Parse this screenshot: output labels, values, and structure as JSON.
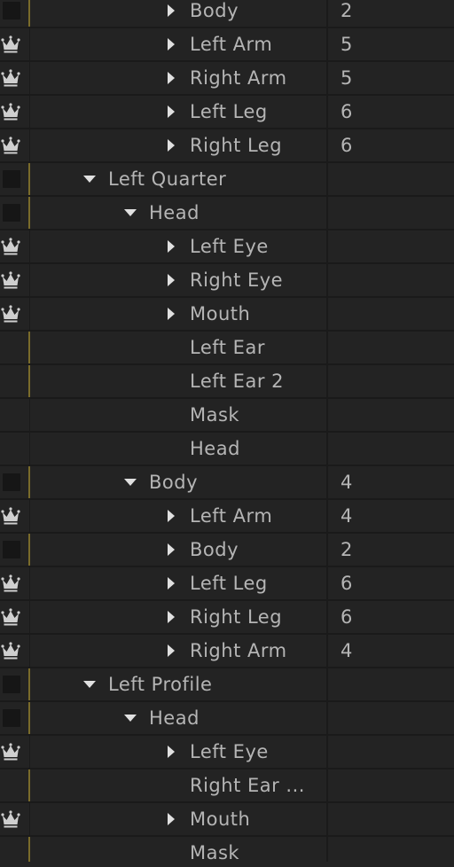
{
  "rows": [
    {
      "label": "Body",
      "value": "2",
      "icon": "box",
      "depth": 2,
      "arrow": "right",
      "accent": true
    },
    {
      "label": "Left Arm",
      "value": "5",
      "icon": "crown",
      "depth": 2,
      "arrow": "right",
      "accent": false
    },
    {
      "label": "Right Arm",
      "value": "5",
      "icon": "crown",
      "depth": 2,
      "arrow": "right",
      "accent": false
    },
    {
      "label": "Left Leg",
      "value": "6",
      "icon": "crown",
      "depth": 2,
      "arrow": "right",
      "accent": false
    },
    {
      "label": "Right Leg",
      "value": "6",
      "icon": "crown",
      "depth": 2,
      "arrow": "right",
      "accent": false
    },
    {
      "label": "Left Quarter",
      "value": "",
      "icon": "box",
      "depth": 0,
      "arrow": "down",
      "accent": true
    },
    {
      "label": "Head",
      "value": "",
      "icon": "box",
      "depth": 1,
      "arrow": "down",
      "accent": true
    },
    {
      "label": "Left Eye",
      "value": "",
      "icon": "crown",
      "depth": 2,
      "arrow": "right",
      "accent": false
    },
    {
      "label": "Right Eye",
      "value": "",
      "icon": "crown",
      "depth": 2,
      "arrow": "right",
      "accent": false
    },
    {
      "label": "Mouth",
      "value": "",
      "icon": "crown",
      "depth": 2,
      "arrow": "right",
      "accent": false
    },
    {
      "label": "Left Ear",
      "value": "",
      "icon": "none",
      "depth": 2,
      "arrow": "none",
      "accent": true
    },
    {
      "label": "Left Ear 2",
      "value": "",
      "icon": "none",
      "depth": 2,
      "arrow": "none",
      "accent": true
    },
    {
      "label": "Mask",
      "value": "",
      "icon": "none",
      "depth": 2,
      "arrow": "none",
      "accent": false
    },
    {
      "label": "Head",
      "value": "",
      "icon": "none",
      "depth": 2,
      "arrow": "none",
      "accent": false
    },
    {
      "label": "Body",
      "value": "4",
      "icon": "box",
      "depth": 1,
      "arrow": "down",
      "accent": true
    },
    {
      "label": "Left Arm",
      "value": "4",
      "icon": "crown",
      "depth": 2,
      "arrow": "right",
      "accent": false
    },
    {
      "label": "Body",
      "value": "2",
      "icon": "box",
      "depth": 2,
      "arrow": "right",
      "accent": true
    },
    {
      "label": "Left Leg",
      "value": "6",
      "icon": "crown",
      "depth": 2,
      "arrow": "right",
      "accent": false
    },
    {
      "label": "Right Leg",
      "value": "6",
      "icon": "crown",
      "depth": 2,
      "arrow": "right",
      "accent": false
    },
    {
      "label": "Right Arm",
      "value": "4",
      "icon": "crown",
      "depth": 2,
      "arrow": "right",
      "accent": false
    },
    {
      "label": "Left Profile",
      "value": "",
      "icon": "box",
      "depth": 0,
      "arrow": "down",
      "accent": true
    },
    {
      "label": "Head",
      "value": "",
      "icon": "box",
      "depth": 1,
      "arrow": "down",
      "accent": true
    },
    {
      "label": "Left Eye",
      "value": "",
      "icon": "crown",
      "depth": 2,
      "arrow": "right",
      "accent": false
    },
    {
      "label": "Right Ear ...",
      "value": "",
      "icon": "none",
      "depth": 2,
      "arrow": "none",
      "accent": true
    },
    {
      "label": "Mouth",
      "value": "",
      "icon": "crown",
      "depth": 2,
      "arrow": "right",
      "accent": false
    },
    {
      "label": "Mask",
      "value": "",
      "icon": "none",
      "depth": 2,
      "arrow": "none",
      "accent": true
    }
  ],
  "colors": {
    "background": "#232323",
    "row_divider": "#1a1a1a",
    "text": "#b5b5b5",
    "accent_separator": "#7a6b2a",
    "crown": "#cfcfcf"
  }
}
